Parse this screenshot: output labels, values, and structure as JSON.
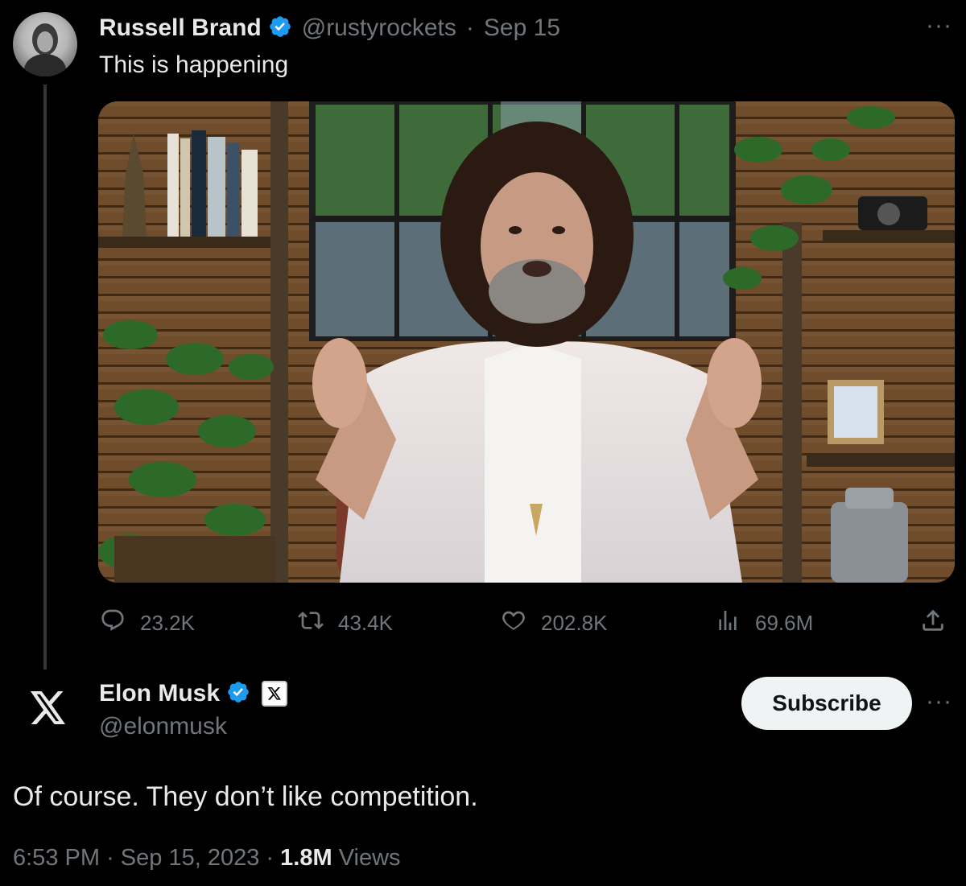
{
  "quoted_tweet": {
    "author_name": "Russell Brand",
    "handle": "@rustyrockets",
    "separator": "·",
    "date": "Sep 15",
    "text": "This is happening",
    "more_label": "···",
    "stats": {
      "replies": "23.2K",
      "reposts": "43.4K",
      "likes": "202.8K",
      "views": "69.6M"
    }
  },
  "main_tweet": {
    "author_name": "Elon Musk",
    "handle": "@elonmusk",
    "subscribe_label": "Subscribe",
    "more_label": "···",
    "text": "Of course. They don’t like competition.",
    "time": "6:53 PM",
    "date": "Sep 15, 2023",
    "views_count": "1.8M",
    "views_label": "Views",
    "dot": "·"
  },
  "colors": {
    "background": "#000000",
    "text": "#e7e9ea",
    "muted": "#71767b",
    "verified_blue": "#1d9bf0",
    "subscribe_bg": "#eff3f4"
  },
  "icons": [
    "avatar",
    "verified-badge-icon",
    "more-icon",
    "reply-icon",
    "repost-icon",
    "like-icon",
    "views-icon",
    "share-icon",
    "x-logo-icon",
    "x-affiliate-badge-icon"
  ]
}
